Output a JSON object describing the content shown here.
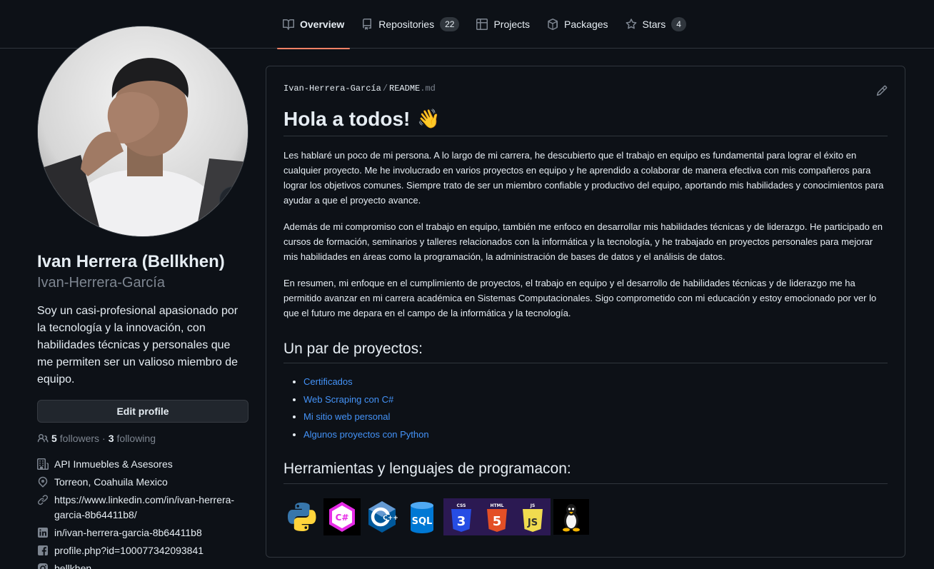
{
  "nav": {
    "tabs": [
      {
        "label": "Overview",
        "icon": "book-icon",
        "active": true
      },
      {
        "label": "Repositories",
        "icon": "repo-icon",
        "count": "22"
      },
      {
        "label": "Projects",
        "icon": "table-icon"
      },
      {
        "label": "Packages",
        "icon": "package-icon"
      },
      {
        "label": "Stars",
        "icon": "star-icon",
        "count": "4"
      }
    ]
  },
  "profile": {
    "fullname": "Ivan Herrera (Bellkhen)",
    "username": "Ivan-Herrera-García",
    "status_emoji": "👾",
    "bio": "Soy un casi-profesional apasionado por la tecnología y la innovación, con habilidades técnicas y personales que me permiten ser un valioso miembro de equipo.",
    "edit_label": "Edit profile",
    "followers_count": "5",
    "followers_label": "followers",
    "following_count": "3",
    "following_label": "following",
    "separator": "·",
    "details": [
      {
        "icon": "organization-icon",
        "text": "API Inmuebles & Asesores"
      },
      {
        "icon": "location-icon",
        "text": "Torreon, Coahuila Mexico"
      },
      {
        "icon": "link-icon",
        "text": "https://www.linkedin.com/in/ivan-herrera-garcia-8b64411b8/"
      },
      {
        "icon": "linkedin-icon",
        "text": "in/ivan-herrera-garcia-8b64411b8"
      },
      {
        "icon": "facebook-icon",
        "text": "profile.php?id=100077342093841"
      },
      {
        "icon": "instagram-icon",
        "text": "bellkhen"
      }
    ]
  },
  "readme": {
    "path_user": "Ivan-Herrera-García",
    "path_sep": "/",
    "path_file": "README",
    "path_ext": ".md",
    "heading": "Hola a todos!",
    "heading_emoji": "👋",
    "paragraphs": [
      "Les hablaré un poco de mi persona. A lo largo de mi carrera, he descubierto que el trabajo en equipo es fundamental para lograr el éxito en cualquier proyecto. Me he involucrado en varios proyectos en equipo y he aprendido a colaborar de manera efectiva con mis compañeros para lograr los objetivos comunes. Siempre trato de ser un miembro confiable y productivo del equipo, aportando mis habilidades y conocimientos para ayudar a que el proyecto avance.",
      "Además de mi compromiso con el trabajo en equipo, también me enfoco en desarrollar mis habilidades técnicas y de liderazgo. He participado en cursos de formación, seminarios y talleres relacionados con la informática y la tecnología, y he trabajado en proyectos personales para mejorar mis habilidades en áreas como la programación, la administración de bases de datos y el análisis de datos.",
      "En resumen, mi enfoque en el cumplimiento de proyectos, el trabajo en equipo y el desarrollo de habilidades técnicas y de liderazgo me ha permitido avanzar en mi carrera académica en Sistemas Computacionales. Sigo comprometido con mi educación y estoy emocionado por ver lo que el futuro me depara en el campo de la informática y la tecnología."
    ],
    "projects_heading": "Un par de proyectos:",
    "projects": [
      "Certificados",
      "Web Scraping con C#",
      "Mi sitio web personal",
      "Algunos proyectos con Python"
    ],
    "tools_heading": "Herramientas y lenguajes de programacon:",
    "tools": [
      {
        "icon": "python-logo",
        "label": ""
      },
      {
        "icon": "csharp-logo",
        "label": "C#"
      },
      {
        "icon": "cpp-logo",
        "label": "C++"
      },
      {
        "icon": "sql-logo",
        "label": "SQL"
      },
      {
        "icon": "css-logo",
        "label": "CSS",
        "num": "3"
      },
      {
        "icon": "html-logo",
        "label": "HTML",
        "num": "5"
      },
      {
        "icon": "js-logo",
        "label": "JS"
      },
      {
        "icon": "linux-logo",
        "label": ""
      }
    ]
  }
}
